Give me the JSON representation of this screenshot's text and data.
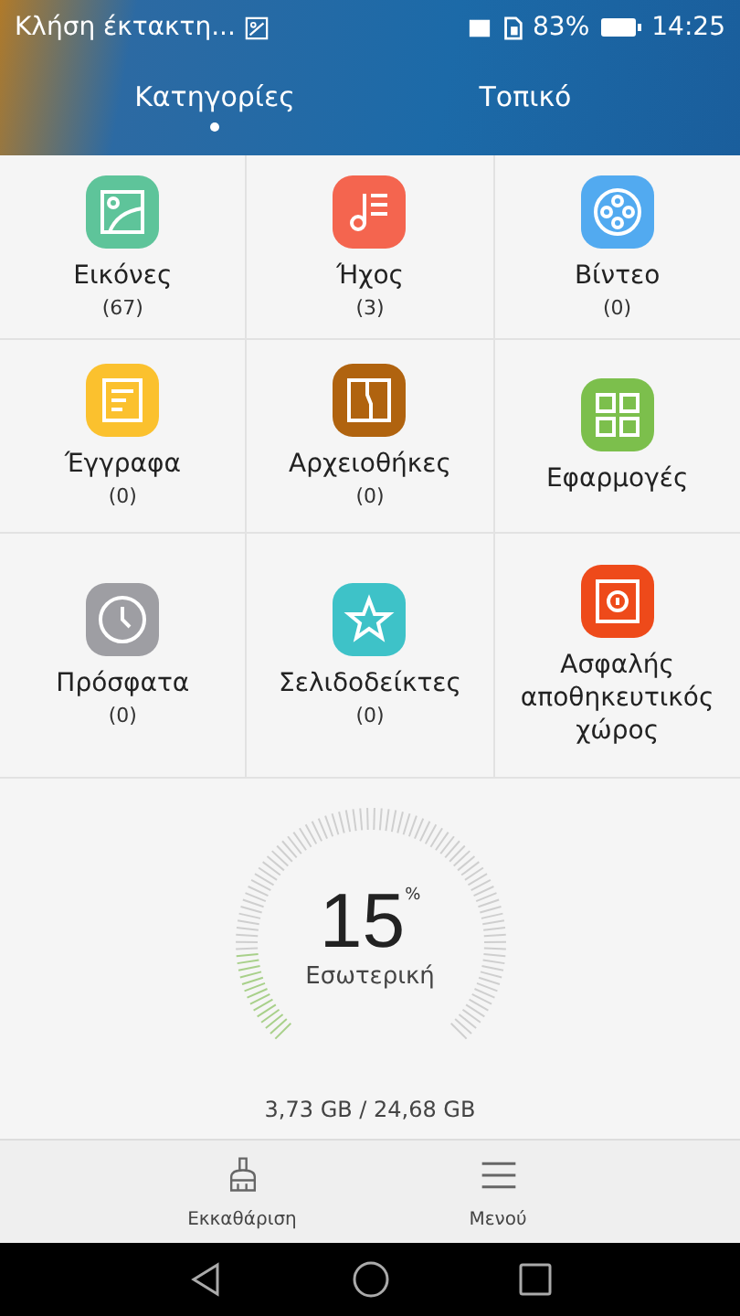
{
  "status_bar": {
    "notification": "Κλήση έκτακτη...",
    "battery": "83%",
    "time": "14:25"
  },
  "tabs": [
    {
      "label": "Κατηγορίες",
      "selected": true
    },
    {
      "label": "Τοπικό",
      "selected": false
    }
  ],
  "categories": [
    {
      "kind": "images",
      "label": "Εικόνες",
      "count": "(67)",
      "color": "#5ec49a"
    },
    {
      "kind": "audio",
      "label": "Ήχος",
      "count": "(3)",
      "color": "#f4654f"
    },
    {
      "kind": "video",
      "label": "Βίντεο",
      "count": "(0)",
      "color": "#52aaf0"
    },
    {
      "kind": "documents",
      "label": "Έγγραφα",
      "count": "(0)",
      "color": "#fbc12e"
    },
    {
      "kind": "archives",
      "label": "Αρχειοθήκες",
      "count": "(0)",
      "color": "#b0630f"
    },
    {
      "kind": "apps",
      "label": "Εφαρμογές",
      "color": "#7cbf4c"
    },
    {
      "kind": "recent",
      "label": "Πρόσφατα",
      "count": "(0)",
      "color": "#9e9ea3"
    },
    {
      "kind": "bookmarks",
      "label": "Σελιδοδείκτες",
      "count": "(0)",
      "color": "#3ec2c8"
    },
    {
      "kind": "safe",
      "label": "Ασφαλής αποθηκευτικός χώρος",
      "color": "#ee4a1a"
    }
  ],
  "storage": {
    "percent": "15",
    "percent_sign": "%",
    "label": "Εσωτερική",
    "usage": "3,73 GB / 24,68 GB"
  },
  "bottom_bar": [
    {
      "kind": "clean",
      "label": "Εκκαθάριση"
    },
    {
      "kind": "menu",
      "label": "Μενού"
    }
  ]
}
